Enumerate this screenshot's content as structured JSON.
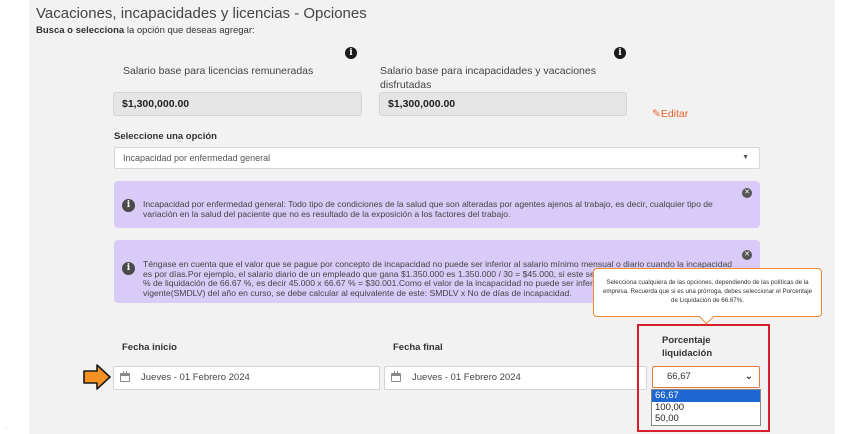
{
  "header": {
    "title": "Vacaciones, incapacidades y licencias - Opciones",
    "subtitle_bold": "Busca o selecciona",
    "subtitle_rest": " la opción que deseas agregar:"
  },
  "salaries": {
    "licencias_label": "Salario base para licencias remuneradas",
    "licencias_value": "$1,300,000.00",
    "vacaciones_label": "Salario base para incapacidades y vacaciones disfrutadas",
    "vacaciones_value": "$1,300,000.00",
    "edit_label": "Editar"
  },
  "option_select": {
    "label": "Seleccione una opción",
    "value": "Incapacidad por enfermedad general"
  },
  "alerts": [
    {
      "text": "Incapacidad por enfermedad general: Todo tipo de condiciones de la salud que son alteradas por agentes ajenos al trabajo, es decir, cualquier tipo de variación en la salud del paciente que no es resultado de la exposición a los factores del trabajo."
    },
    {
      "text": "Téngase en cuenta que el valor que se pague por concepto de incapacidad no puede ser inferior al salario mínimo mensual o diario cuando la incapacidad es por días.Por ejemplo, el salario diario de un empleado que gana $1.350.000 es 1.350.000 / 30 = $45.000, si este se incapacita y supongamos que es con % de liquidación de 66.67 %, es decir 45.000 x 66.67 % = $30.001.Como el valor de la incapacidad no puede ser inferior al salario mínimo diario legal vigente(SMDLV) del año en curso, se debe calcular al equivalente de este: SMDLV x No de días de incapacidad."
    }
  ],
  "tooltip": {
    "text": "Selecciona cualquiera de las opciones, dependiendo de las políticas de la empresa. Recuerda que si es una prórroga, debes seleccionar el Porcentaje de Liquidación de 66.67%."
  },
  "dates": {
    "start_label": "Fecha inicio",
    "start_value": "Jueves - 01 Febrero 2024",
    "end_label": "Fecha final",
    "end_value": "Jueves - 01 Febrero 2024"
  },
  "percentage": {
    "label": "Porcentaje liquidación",
    "selected": "66,67",
    "options": [
      "66,67",
      "100,00",
      "50,00"
    ]
  },
  "colors": {
    "alert_bg": "#d9cbf7",
    "accent_orange": "#e8622a",
    "highlight_red": "#d8202a",
    "selected_blue": "#1e66d0"
  }
}
